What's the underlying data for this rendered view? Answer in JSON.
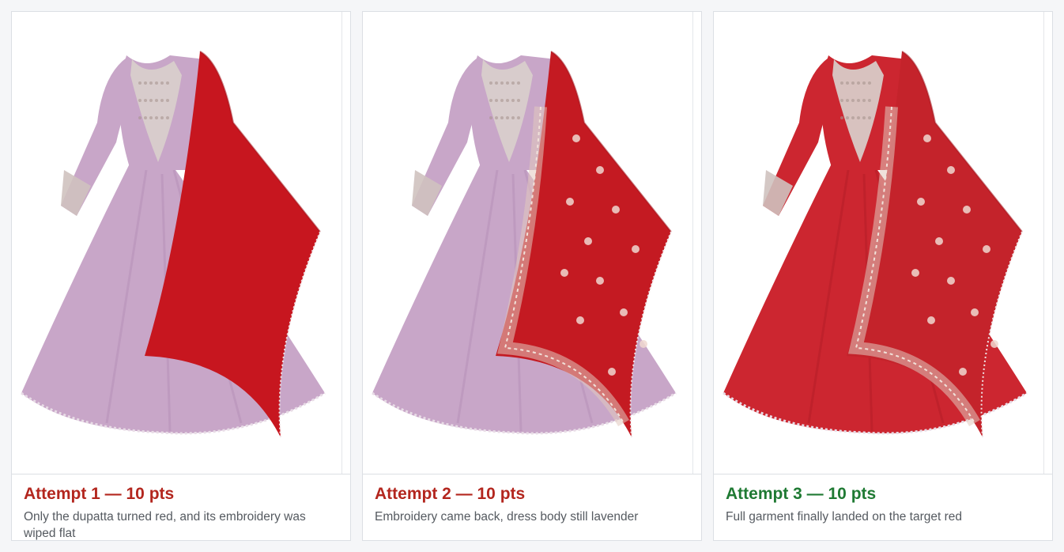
{
  "attempts": [
    {
      "title": "Attempt 1 — 10 pts",
      "description": "Only the dupatta turned red, and its embroidery was wiped flat",
      "title_color": "#b3261e",
      "dress_color": "#c8a6c8",
      "dress_shade": "#b692b8",
      "dupatta_color": "#c7161f",
      "dupatta_patterned": false
    },
    {
      "title": "Attempt 2 — 10 pts",
      "description": "Embroidery came back, dress body still lavender",
      "title_color": "#b3261e",
      "dress_color": "#c8a6c8",
      "dress_shade": "#b692b8",
      "dupatta_color": "#c41a22",
      "dupatta_patterned": true
    },
    {
      "title": "Attempt 3 — 10 pts",
      "description": "Full garment finally landed on the target red",
      "title_color": "#1f7a33",
      "dress_color": "#cc2630",
      "dress_shade": "#b51d27",
      "dupatta_color": "#c4232b",
      "dupatta_patterned": true
    }
  ]
}
